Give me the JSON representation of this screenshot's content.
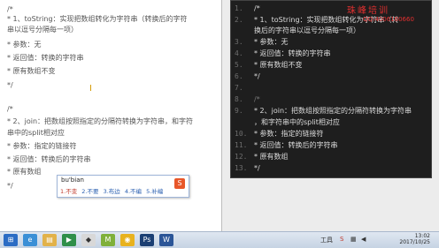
{
  "left_editor": {
    "lines": [
      "/*",
      " * 1、toString：实现把数组转化为字符串（转换后的字符",
      "串以逗号分隔每一项）",
      " *   参数：无",
      " *   返回值：转换的字符串",
      " *   原有数组不变",
      " */",
      "",
      "/*",
      " * 2、join：把数组按照指定的分隔符转换为字符串，和字符",
      "串中的split相对应",
      " *   参数：指定的链接符",
      " *   返回值：转换后的字符串",
      " *   原有数组",
      " */"
    ]
  },
  "ime": {
    "pinyin": "bu'bian",
    "candidates": [
      "1.不变",
      "2.不要",
      "3.布边",
      "4.不编",
      "5.补编"
    ],
    "logo_glyph": "S"
  },
  "right_panel": {
    "rows": [
      {
        "num": "1.",
        "code": "/*"
      },
      {
        "num": "2.",
        "code": " * 1、toString：实现把数组转化为字符串（转"
      },
      {
        "num": "",
        "code": "换后的字符串以逗号分隔每一项）"
      },
      {
        "num": "3.",
        "code": " *   参数：无"
      },
      {
        "num": "4.",
        "code": " *   返回值：转换的字符串"
      },
      {
        "num": "5.",
        "code": " *   原有数组不变"
      },
      {
        "num": "6.",
        "code": " */"
      },
      {
        "num": "7.",
        "code": ""
      },
      {
        "num": "8.",
        "code": "/*"
      },
      {
        "num": "9.",
        "code": " * 2、join：把数组按照指定的分隔符转换为字符串"
      },
      {
        "num": "",
        "code": "，和字符串中的split相对应"
      },
      {
        "num": "10.",
        "code": " *   参数：指定的链接符"
      },
      {
        "num": "11.",
        "code": " *   返回值：转换后的字符串"
      },
      {
        "num": "12.",
        "code": " *   原有数组"
      },
      {
        "num": "13.",
        "code": " */"
      }
    ]
  },
  "watermark": {
    "text": "珠峰培训",
    "qq": "QQ:4006160660"
  },
  "taskbar": {
    "icons": [
      "windows-start-icon",
      "ie-icon",
      "folder-icon",
      "media-icon",
      "app-icon",
      "m-icon",
      "chrome-icon",
      "ps-icon",
      "word-icon"
    ],
    "tools_label": "工具",
    "clock_time": "13:02",
    "clock_date": "2017/10/25"
  },
  "colors": {
    "accent": "#e03030",
    "panel_bg": "#1e1e1e"
  }
}
